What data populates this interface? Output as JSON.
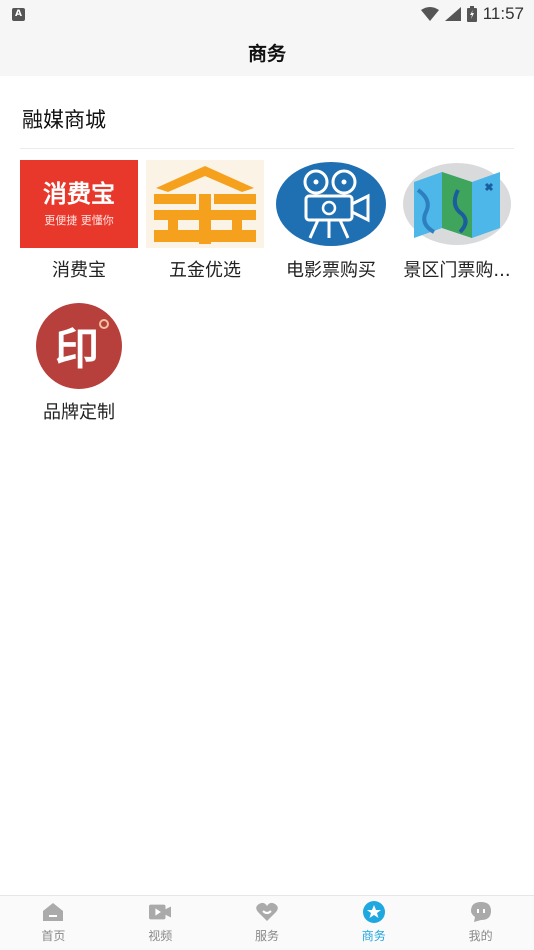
{
  "status_bar": {
    "badge": "A",
    "time": "11:57"
  },
  "header": {
    "title": "商务"
  },
  "section": {
    "title": "融媒商城"
  },
  "items": [
    {
      "label": "消费宝",
      "icon": "xiaofeibao-logo",
      "logo_main": "消费宝",
      "logo_sub": "更便捷  更懂你",
      "color": "#e8372b"
    },
    {
      "label": "五金优选",
      "icon": "hardware-logo",
      "color": "#f5a11e"
    },
    {
      "label": "电影票购买",
      "icon": "movie-camera-icon",
      "color": "#1f6fb3"
    },
    {
      "label": "景区门票购...",
      "icon": "map-icon",
      "color": "#4cb7e8"
    },
    {
      "label": "品牌定制",
      "icon": "brand-seal-icon",
      "logo_main": "印",
      "color": "#b7403c"
    }
  ],
  "bottom_nav": [
    {
      "label": "首页",
      "icon": "home-icon"
    },
    {
      "label": "视频",
      "icon": "video-icon"
    },
    {
      "label": "服务",
      "icon": "heart-icon"
    },
    {
      "label": "商务",
      "icon": "star-circle-icon",
      "active": true
    },
    {
      "label": "我的",
      "icon": "profile-icon"
    }
  ],
  "colors": {
    "accent": "#1fa7e0",
    "inactive": "#888888"
  }
}
